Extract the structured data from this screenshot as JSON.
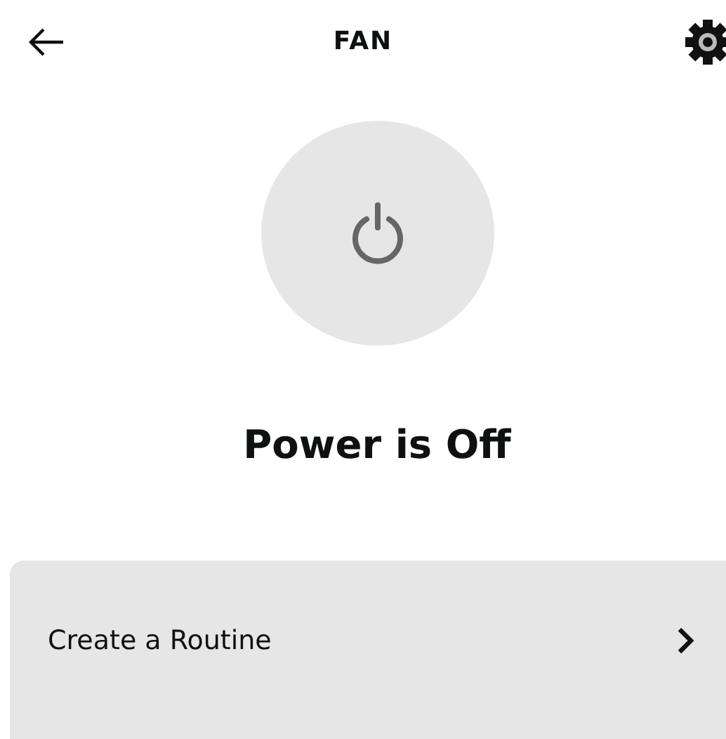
{
  "header": {
    "title": "FAN"
  },
  "power": {
    "on": false,
    "status": "Power is Off"
  },
  "menu_items": [
    {
      "label": "Create a Routine"
    }
  ]
}
